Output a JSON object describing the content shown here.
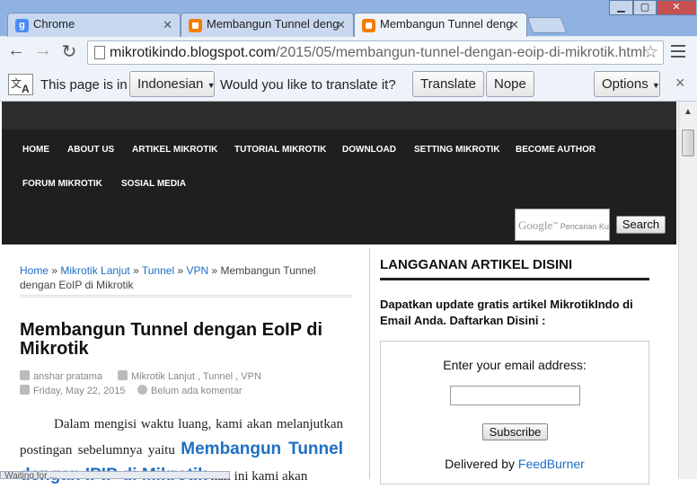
{
  "browser": {
    "tabs": [
      {
        "title": "Chrome",
        "favicon": "google-icon",
        "active": false
      },
      {
        "title": "Membangun Tunnel deng",
        "favicon": "blogger-icon",
        "active": false
      },
      {
        "title": "Membangun Tunnel deng",
        "favicon": "blogger-icon",
        "active": true
      }
    ],
    "url_host": "mikrotikindo.blogspot.com",
    "url_path": "/2015/05/membangun-tunnel-dengan-eoip-di-mikrotik.html",
    "google_g": "g"
  },
  "translate_bar": {
    "prompt": "This page is in",
    "language": "Indonesian",
    "question": "Would you like to translate it?",
    "translate_label": "Translate",
    "nope_label": "Nope",
    "options_label": "Options"
  },
  "site": {
    "menu": [
      "HOME",
      "ABOUT US",
      "ARTIKEL MIKROTIK",
      "TUTORIAL MIKROTIK",
      "DOWNLOAD",
      "SETTING MIKROTIK",
      "BECOME AUTHOR",
      "FORUM MIKROTIK",
      "SOSIAL MEDIA"
    ],
    "search_placeholder": "Pencarian Ku",
    "search_google": "Google",
    "search_button": "Search"
  },
  "breadcrumb": {
    "home": "Home",
    "c1": "Mikrotik Lanjut",
    "c2": "Tunnel",
    "c3": "VPN",
    "current": "Membangun Tunnel dengan EoIP di Mikrotik",
    "sep": " » "
  },
  "post": {
    "title": "Membangun Tunnel dengan EoIP di Mikrotik",
    "author": "anshar pratama",
    "labels": "Mikrotik Lanjut , Tunnel , VPN",
    "date": "Friday, May 22, 2015",
    "comments": "Belum ada komentar",
    "body_intro": "Dalam mengisi waktu luang, kami akan melanjutkan postingan sebelumnya yaitu",
    "body_link": "Membangun Tunnel dengan IPIP di Mikrotik",
    "body_rest": "kali ini kami akan"
  },
  "sidebar": {
    "title": "LANGGANAN ARTIKEL DISINI",
    "desc": "Dapatkan update gratis artikel MikrotikIndo di Email Anda. Daftarkan Disini :",
    "email_label": "Enter your email address:",
    "subscribe_label": "Subscribe",
    "delivered_by": "Delivered by",
    "feedburner": "FeedBurner"
  },
  "status_text": "Waiting for ... "
}
